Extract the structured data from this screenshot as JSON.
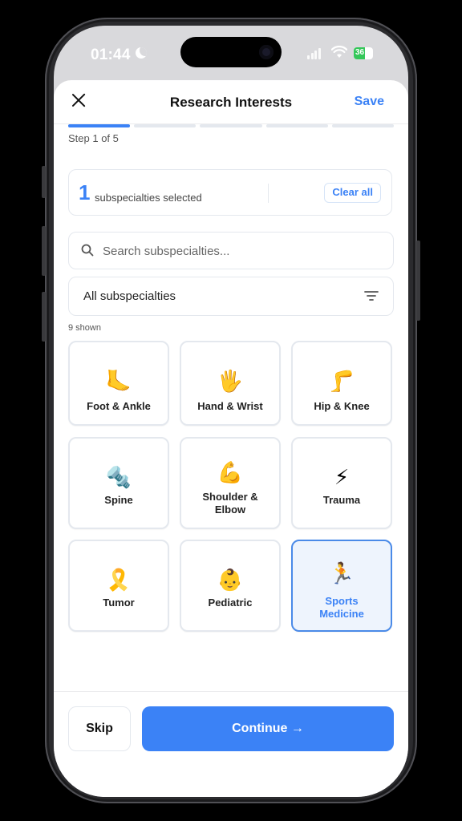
{
  "status_bar": {
    "time": "01:44",
    "battery": "36"
  },
  "header": {
    "title": "Research Interests",
    "save_label": "Save"
  },
  "progress": {
    "step_text": "Step 1 of 5",
    "current_step": 1,
    "total_steps": 5
  },
  "selection": {
    "count": "1",
    "text": "subspecialties selected",
    "clear_label": "Clear all"
  },
  "search": {
    "placeholder": "Search subspecialties...",
    "value": ""
  },
  "filter": {
    "selected": "All subspecialties"
  },
  "results": {
    "shown_text": "9 shown"
  },
  "subspecialties": [
    {
      "name": "foot-ankle",
      "emoji": "🦶",
      "label": "Foot & Ankle",
      "selected": false
    },
    {
      "name": "hand-wrist",
      "emoji": "🖐️",
      "label": "Hand & Wrist",
      "selected": false
    },
    {
      "name": "hip-knee",
      "emoji": "🦵",
      "label": "Hip & Knee",
      "selected": false
    },
    {
      "name": "spine",
      "emoji": "🔩",
      "label": "Spine",
      "selected": false
    },
    {
      "name": "shoulder-elbow",
      "emoji": "💪",
      "label": "Shoulder & Elbow",
      "selected": false
    },
    {
      "name": "trauma",
      "emoji": "⚡",
      "label": "Trauma",
      "selected": false
    },
    {
      "name": "tumor",
      "emoji": "🎗️",
      "label": "Tumor",
      "selected": false
    },
    {
      "name": "pediatric",
      "emoji": "👶",
      "label": "Pediatric",
      "selected": false
    },
    {
      "name": "sports-medicine",
      "emoji": "🏃",
      "label": "Sports Medicine",
      "selected": true
    }
  ],
  "footer": {
    "skip_label": "Skip",
    "continue_label": "Continue →"
  },
  "colors": {
    "accent": "#3b82f6",
    "border": "#e4e8ee",
    "selected_bg": "#eef4fd"
  }
}
